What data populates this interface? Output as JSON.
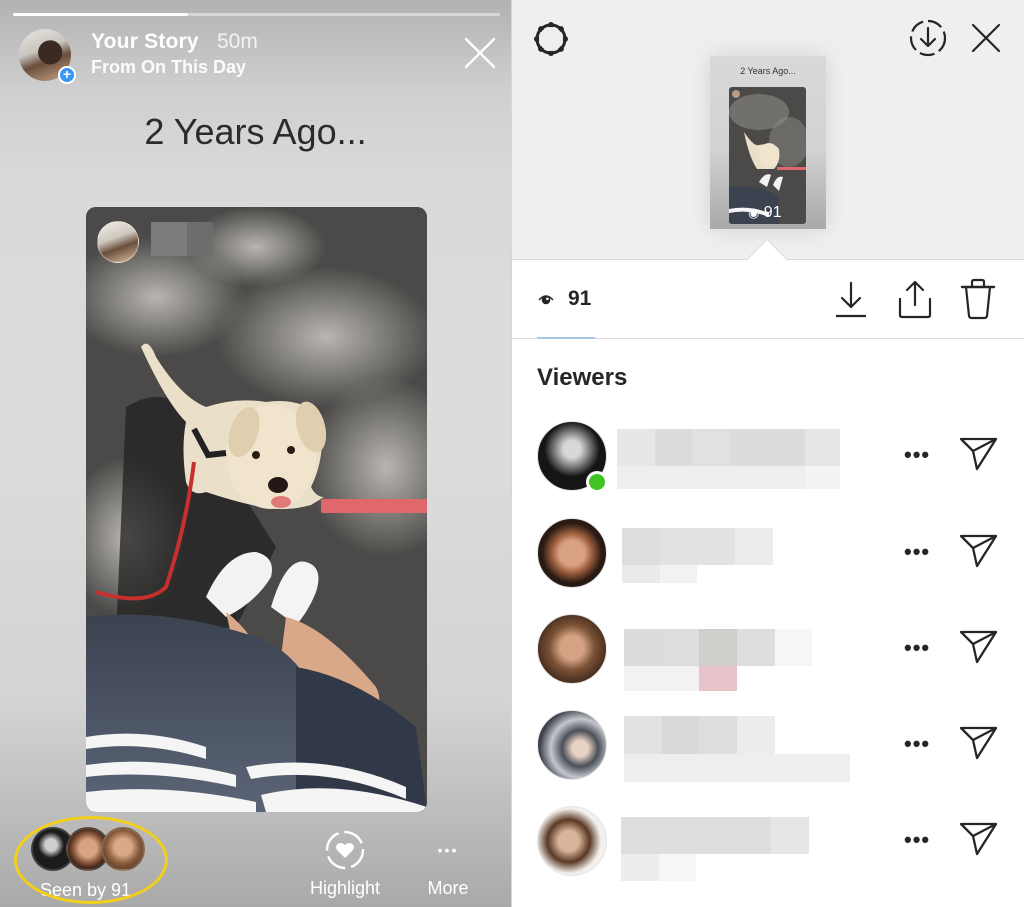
{
  "story": {
    "progress": 0.36,
    "title": "Your Story",
    "time": "50m",
    "subtitle": "From On This Day",
    "heading": "2 Years Ago...",
    "add_badge": "+",
    "seen_by": "Seen by 91",
    "actions": [
      {
        "label": "Highlight",
        "icon": "heart-circle-dashed-icon"
      },
      {
        "label": "More",
        "icon": "more-dots-icon",
        "glyph": "•••"
      }
    ],
    "colors": {
      "highlight_ring": "#f3cf1b",
      "badge": "#3897f0"
    }
  },
  "insights": {
    "thumbnail": {
      "title": "2 Years Ago...",
      "count": "91"
    },
    "view_count": "91",
    "viewers_title": "Viewers",
    "viewers": [
      {
        "online": true,
        "more": "•••"
      },
      {
        "online": false,
        "more": "•••"
      },
      {
        "online": false,
        "more": "•••"
      },
      {
        "online": false,
        "more": "•••"
      },
      {
        "online": false,
        "more": "•••"
      }
    ],
    "colors": {
      "online": "#3fc421",
      "tab_underline": "#a9c6e6"
    }
  }
}
